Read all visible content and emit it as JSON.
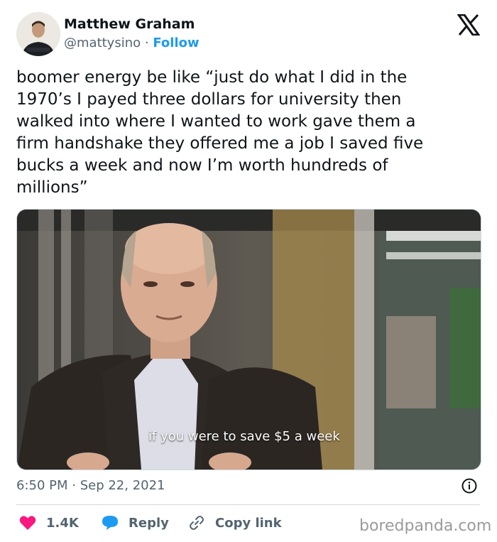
{
  "author": {
    "name": "Matthew Graham",
    "handle": "@mattysino",
    "separator": "·",
    "follow_label": "Follow"
  },
  "platform_icon": "x-logo-icon",
  "tweet": {
    "lines": [
      "boomer energy be like “just do what I did in the",
      "1970’s I payed three dollars for university then",
      "walked into where I wanted to work gave them a",
      "firm handshake they offered me a job I saved five",
      "bucks a week and now I’m worth hundreds of",
      "millions”"
    ]
  },
  "media": {
    "caption": "if you were to save $5 a week"
  },
  "meta": {
    "timestamp": "6:50 PM · Sep 22, 2021",
    "info_icon": "info-icon"
  },
  "actions": {
    "like_count": "1.4K",
    "reply_label": "Reply",
    "copy_label": "Copy link"
  },
  "colors": {
    "like": "#f91880",
    "reply": "#1d9bf0",
    "link": "#1d9bf0",
    "muted": "#536471"
  },
  "watermark": "boredpanda.com"
}
